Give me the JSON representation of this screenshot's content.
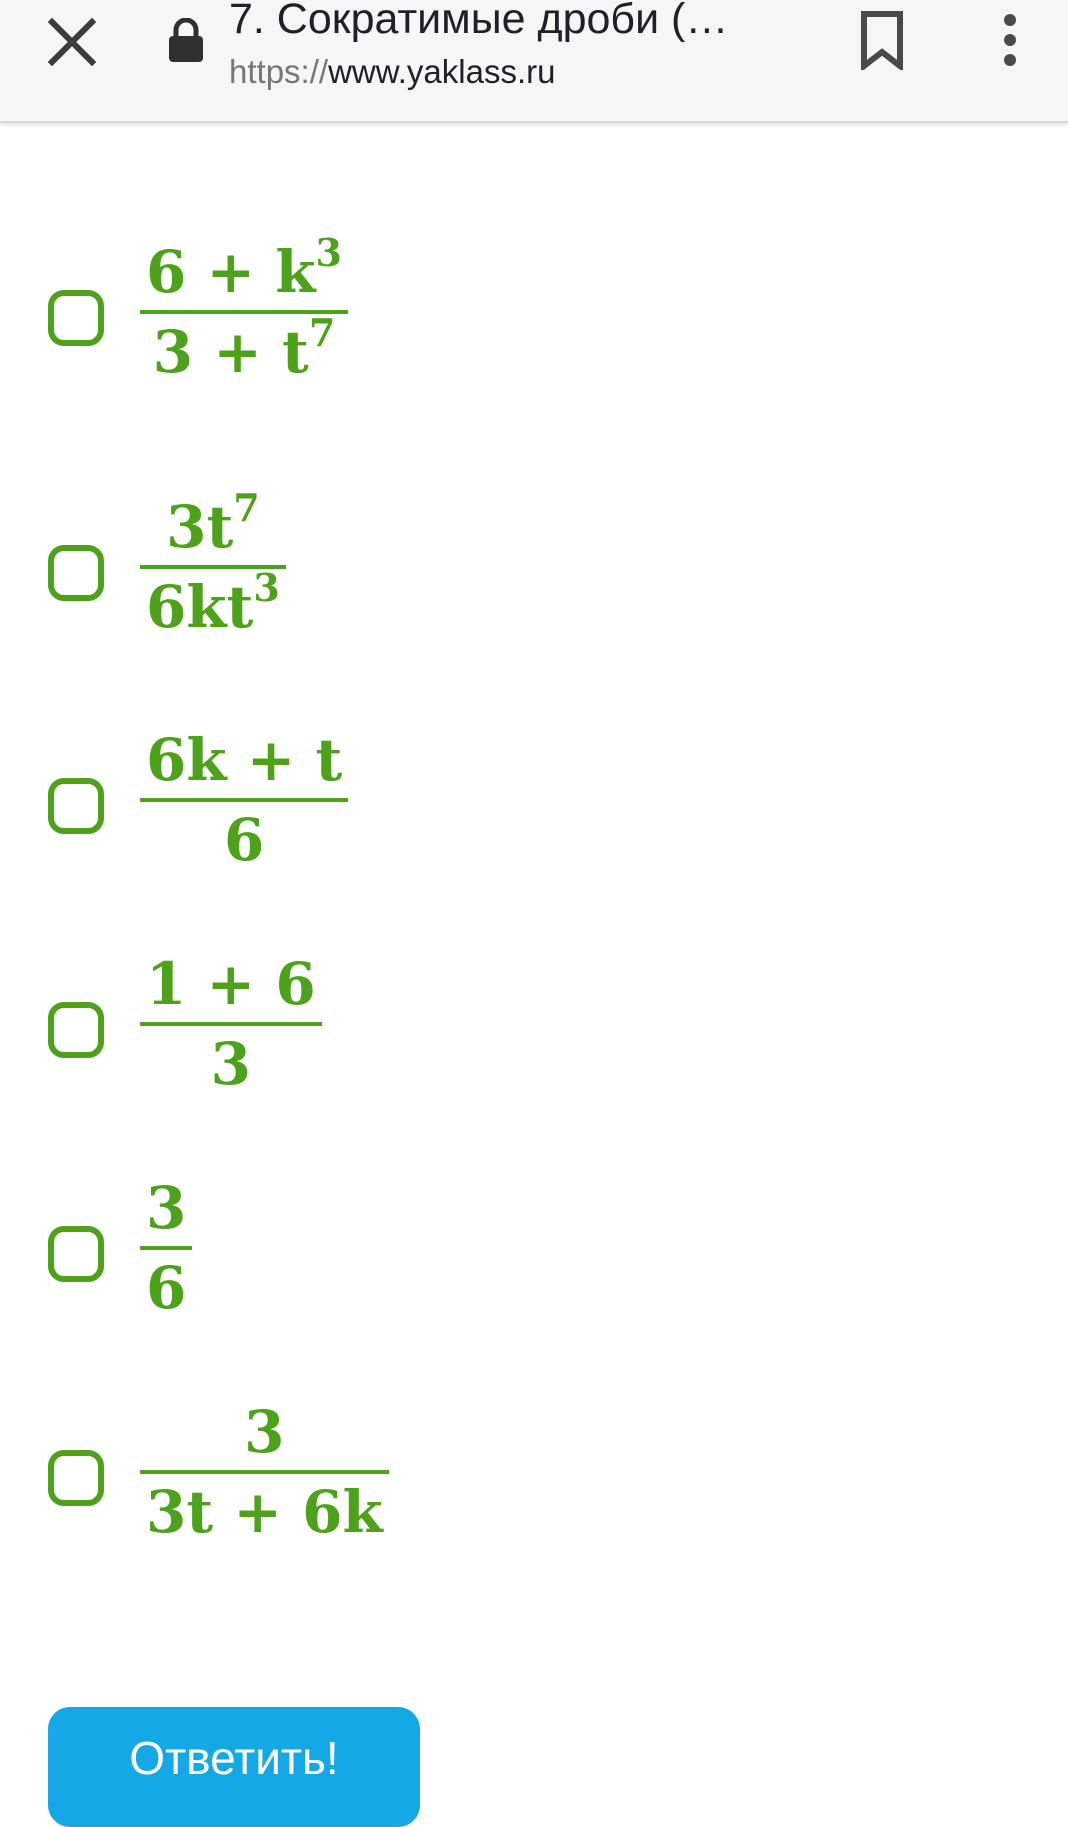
{
  "browser": {
    "title": "7. Сократимые дроби (…",
    "url_scheme": "https://",
    "url_host": "www.yaklass.ru",
    "icons": [
      "close-icon",
      "lock-icon",
      "bookmark-icon",
      "more-vert-icon"
    ]
  },
  "options": [
    {
      "num": "6 + k",
      "num_sup": "3",
      "den": "3 + t",
      "den_sup": "7"
    },
    {
      "num": "3t",
      "num_sup": "7",
      "den": "6kt",
      "den_sup": "3"
    },
    {
      "num": "6k + t",
      "num_sup": "",
      "den": "6",
      "den_sup": ""
    },
    {
      "num": "1 + 6",
      "num_sup": "",
      "den": "3",
      "den_sup": ""
    },
    {
      "num": "3",
      "num_sup": "",
      "den": "6",
      "den_sup": ""
    },
    {
      "num": "3",
      "num_sup": "",
      "den": "3t + 6k",
      "den_sup": ""
    }
  ],
  "answer_button": {
    "label": "Ответить!"
  },
  "colors": {
    "accent_green": "#4ea11b",
    "button_blue": "#14a9e6"
  }
}
